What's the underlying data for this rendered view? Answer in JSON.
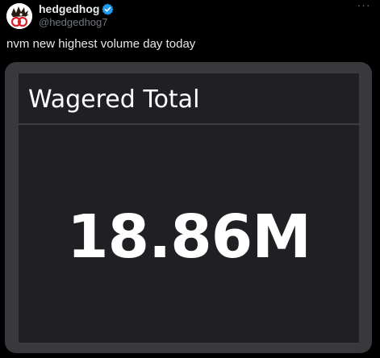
{
  "author": {
    "display_name": "hedgedhog",
    "handle": "@hedgedhog7",
    "verified": true,
    "avatar_icon": "hedgehog-logo-icon"
  },
  "tweet": {
    "text": "nvm new highest volume day today",
    "more_icon": "ellipsis-icon",
    "more_label": "···"
  },
  "media": {
    "panel_title": "Wagered Total",
    "panel_value": "18.86M"
  },
  "colors": {
    "background": "#000000",
    "text_primary": "#e7e9ea",
    "text_secondary": "#71767b",
    "verified_badge": "#1d9bf0",
    "panel_background": "#201f24",
    "media_frame": "#38383d"
  }
}
